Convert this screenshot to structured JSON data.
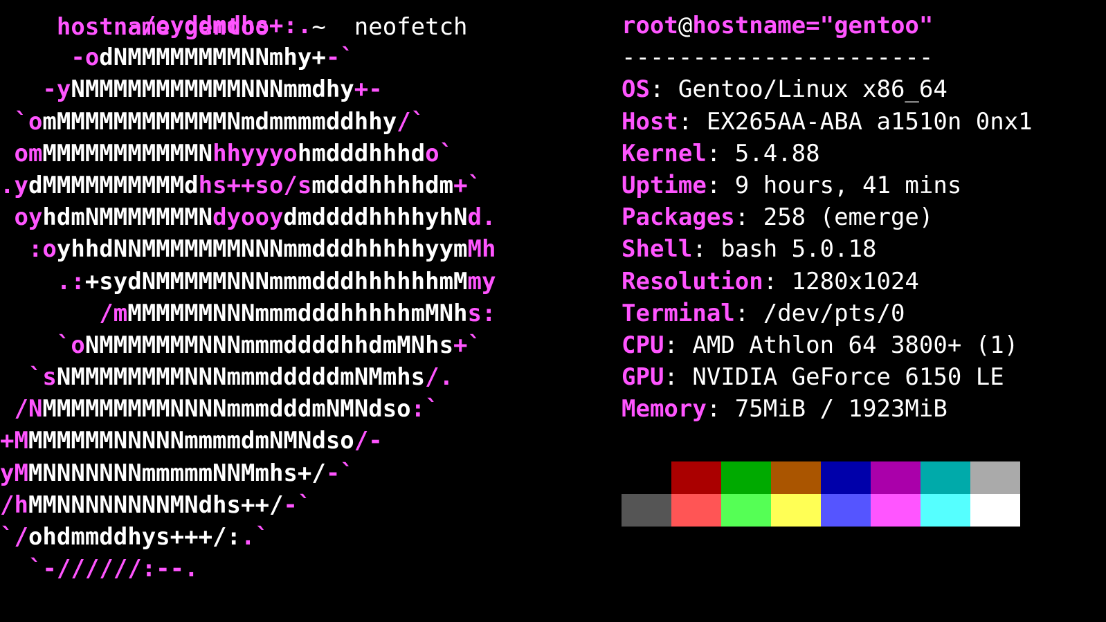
{
  "command_line": {
    "prompt_user": "hostname",
    "prompt_rest": " gentoo",
    "command": "   ~  neofetch"
  },
  "logo": {
    "lines": [
      [
        [
          "m",
          "         -/oyddmdhs+:."
        ]
      ],
      [
        [
          "m",
          "     -o"
        ],
        [
          "w",
          "dNMMMMMMMMNNmhy+"
        ],
        [
          "m",
          "-`"
        ]
      ],
      [
        [
          "m",
          "   -y"
        ],
        [
          "w",
          "NMMMMMMMMMMMNNNmmdhy"
        ],
        [
          "m",
          "+-"
        ]
      ],
      [
        [
          "m",
          " `o"
        ],
        [
          "w",
          "mMMMMMMMMMMMMNmdmmmmddhhy"
        ],
        [
          "m",
          "/`"
        ]
      ],
      [
        [
          "m",
          " om"
        ],
        [
          "w",
          "MMMMMMMMMMMN"
        ],
        [
          "m",
          "hhyyyo"
        ],
        [
          "w",
          "hmdddhhhd"
        ],
        [
          "m",
          "o`"
        ]
      ],
      [
        [
          "m",
          ".y"
        ],
        [
          "w",
          "dMMMMMMMMMMd"
        ],
        [
          "m",
          "hs++so/s"
        ],
        [
          "w",
          "mdddhhhhdm"
        ],
        [
          "m",
          "+`"
        ]
      ],
      [
        [
          "m",
          " oy"
        ],
        [
          "w",
          "hdmNMMMMMMMN"
        ],
        [
          "m",
          "dyooy"
        ],
        [
          "w",
          "dmddddhhhhyhN"
        ],
        [
          "m",
          "d."
        ]
      ],
      [
        [
          "m",
          "  :o"
        ],
        [
          "w",
          "yhhdNNMMMMMMMNNNmmdddhhhhhyym"
        ],
        [
          "m",
          "Mh"
        ]
      ],
      [
        [
          "m",
          "    .:"
        ],
        [
          "w",
          "+sydNMMMMMNNNmmmdddhhhhhhmM"
        ],
        [
          "m",
          "my"
        ]
      ],
      [
        [
          "m",
          "       /m"
        ],
        [
          "w",
          "MMMMMMNNNmmmdddhhhhhmMNh"
        ],
        [
          "m",
          "s:"
        ]
      ],
      [
        [
          "m",
          "    `o"
        ],
        [
          "w",
          "NMMMMMMMNNNmmmddddhhdmMNhs"
        ],
        [
          "m",
          "+`"
        ]
      ],
      [
        [
          "m",
          "  `s"
        ],
        [
          "w",
          "NMMMMMMMMNNNmmmdddddmNMmhs"
        ],
        [
          "m",
          "/."
        ]
      ],
      [
        [
          "m",
          " /N"
        ],
        [
          "w",
          "MMMMMMMMMNNNNmmmdddmNMNdso"
        ],
        [
          "m",
          ":`"
        ]
      ],
      [
        [
          "m",
          "+M"
        ],
        [
          "w",
          "MMMMMMNNNNNmmmmdmNMNdso"
        ],
        [
          "m",
          "/-"
        ]
      ],
      [
        [
          "m",
          "yM"
        ],
        [
          "w",
          "MNNNNNNNmmmmmNNMmhs+/"
        ],
        [
          "m",
          "-`"
        ]
      ],
      [
        [
          "m",
          "/h"
        ],
        [
          "w",
          "MMNNNNNNNNMNdhs++/"
        ],
        [
          "m",
          "-`"
        ]
      ],
      [
        [
          "m",
          "`/"
        ],
        [
          "w",
          "ohdmmddhys+++/:"
        ],
        [
          "m",
          ".`"
        ]
      ],
      [
        [
          "m",
          "  `-//////:--."
        ]
      ]
    ]
  },
  "info": {
    "title": {
      "user": "root",
      "at": "@",
      "host": "hostname=\"gentoo\""
    },
    "separator": "----------------------",
    "fields": [
      {
        "key": "OS",
        "value": " Gentoo/Linux x86_64"
      },
      {
        "key": "Host",
        "value": " EX265AA-ABA a1510n 0nx1"
      },
      {
        "key": "Kernel",
        "value": " 5.4.88"
      },
      {
        "key": "Uptime",
        "value": " 9 hours, 41 mins"
      },
      {
        "key": "Packages",
        "value": " 258 (emerge)"
      },
      {
        "key": "Shell",
        "value": " bash 5.0.18"
      },
      {
        "key": "Resolution",
        "value": " 1280x1024"
      },
      {
        "key": "Terminal",
        "value": " /dev/pts/0"
      },
      {
        "key": "CPU",
        "value": " AMD Athlon 64 3800+ (1)"
      },
      {
        "key": "GPU",
        "value": " NVIDIA GeForce 6150 LE"
      },
      {
        "key": "Memory",
        "value": " 75MiB / 1923MiB"
      }
    ]
  },
  "palette": {
    "normal": [
      "#000000",
      "#aa0000",
      "#00aa00",
      "#aa5500",
      "#0000aa",
      "#aa00aa",
      "#00aaaa",
      "#aaaaaa"
    ],
    "bright": [
      "#555555",
      "#ff5555",
      "#55ff55",
      "#ffff55",
      "#5555ff",
      "#ff55ff",
      "#55ffff",
      "#ffffff"
    ]
  }
}
